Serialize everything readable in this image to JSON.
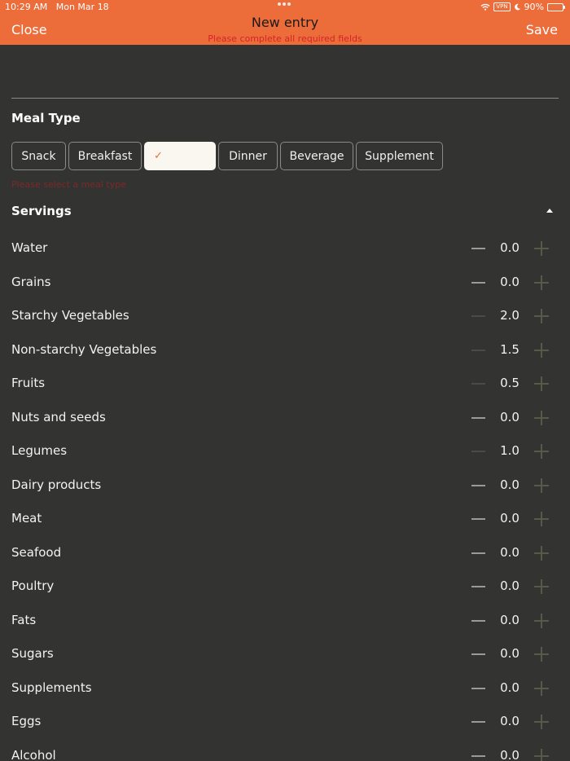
{
  "status_bar": {
    "time": "10:29 AM",
    "date": "Mon Mar 18",
    "vpn": "VPN",
    "battery": "90%",
    "battery_level": 0.9
  },
  "header": {
    "title": "New entry",
    "warning": "Please complete all required fields",
    "close_label": "Close",
    "save_label": "Save"
  },
  "meal_type": {
    "title": "Meal Type",
    "options": [
      "Snack",
      "Breakfast",
      "",
      "Dinner",
      "Beverage",
      "Supplement"
    ],
    "selected_index": 2,
    "error": "Please select a meal type"
  },
  "servings": {
    "title": "Servings",
    "items": [
      {
        "label": "Water",
        "value": "0.0"
      },
      {
        "label": "Grains",
        "value": "0.0"
      },
      {
        "label": "Starchy Vegetables",
        "value": "2.0"
      },
      {
        "label": "Non-starchy Vegetables",
        "value": "1.5"
      },
      {
        "label": "Fruits",
        "value": "0.5"
      },
      {
        "label": "Nuts and seeds",
        "value": "0.0"
      },
      {
        "label": "Legumes",
        "value": "1.0"
      },
      {
        "label": "Dairy products",
        "value": "0.0"
      },
      {
        "label": "Meat",
        "value": "0.0"
      },
      {
        "label": "Seafood",
        "value": "0.0"
      },
      {
        "label": "Poultry",
        "value": "0.0"
      },
      {
        "label": "Fats",
        "value": "0.0"
      },
      {
        "label": "Sugars",
        "value": "0.0"
      },
      {
        "label": "Supplements",
        "value": "0.0"
      },
      {
        "label": "Eggs",
        "value": "0.0"
      },
      {
        "label": "Alcohol",
        "value": "0.0"
      }
    ]
  },
  "colors": {
    "accent": "#ec6c3a",
    "background": "#333331",
    "warning": "#d4242a"
  }
}
